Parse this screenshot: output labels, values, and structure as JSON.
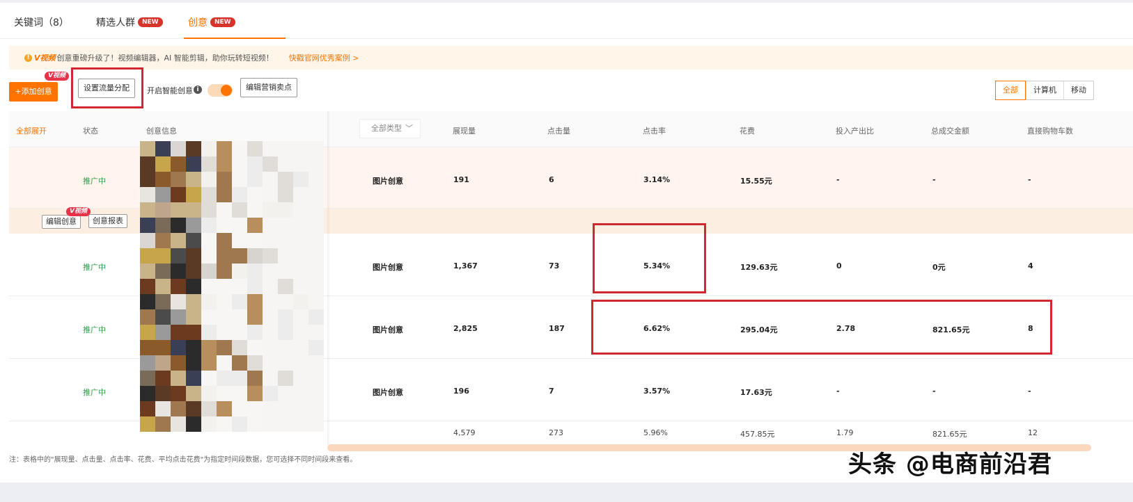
{
  "tabs": [
    {
      "label": "关键词（8）",
      "badge": ""
    },
    {
      "label": "精选人群",
      "badge": "NEW"
    },
    {
      "label": "创意",
      "badge": "NEW"
    }
  ],
  "notice": {
    "info_icon": "info-circle-icon",
    "brand": "V视频",
    "text": "创意重磅升级了！视频编辑器，AI 智能剪辑，助你玩转短视频！",
    "link": "快戳官网优秀案例 >"
  },
  "toolbar": {
    "add_label": "+添加创意",
    "v_badge": "V视频",
    "traffic_label": "设置流量分配",
    "smart_label": "开启智能创意",
    "edit_selling_label": "编辑营销卖点",
    "segments": [
      "全部",
      "计算机",
      "移动"
    ]
  },
  "table": {
    "headers": {
      "expand": "全部展开",
      "status": "状态",
      "info": "创意信息",
      "type_select": "全部类型",
      "impressions": "展现量",
      "clicks": "点击量",
      "ctr": "点击率",
      "cost": "花费",
      "roi": "投入产出比",
      "gmv": "总成交金额",
      "cart": "直接购物车数"
    },
    "rows": [
      {
        "status": "推广中",
        "type": "图片创意",
        "impressions": "191",
        "clicks": "6",
        "ctr": "3.14%",
        "cost": "15.55元",
        "roi": "-",
        "gmv": "-",
        "cart": "-"
      },
      {
        "status": "推广中",
        "type": "图片创意",
        "impressions": "1,367",
        "clicks": "73",
        "ctr": "5.34%",
        "cost": "129.63元",
        "roi": "0",
        "gmv": "0元",
        "cart": "4"
      },
      {
        "status": "推广中",
        "type": "图片创意",
        "impressions": "2,825",
        "clicks": "187",
        "ctr": "6.62%",
        "cost": "295.04元",
        "roi": "2.78",
        "gmv": "821.65元",
        "cart": "8"
      },
      {
        "status": "推广中",
        "type": "图片创意",
        "impressions": "196",
        "clicks": "7",
        "ctr": "3.57%",
        "cost": "17.63元",
        "roi": "-",
        "gmv": "-",
        "cart": "-"
      }
    ],
    "row_actions": {
      "edit": "编辑创意",
      "report": "创意报表",
      "v_badge": "V视频"
    },
    "totals": {
      "impressions": "4,579",
      "clicks": "273",
      "ctr": "5.96%",
      "cost": "457.85元",
      "roi": "1.79",
      "gmv": "821.65元",
      "cart": "12"
    }
  },
  "footnote": "注：表格中的\"展现量、点击量、点击率、花费、平均点击花费\"为指定时间段数据，您可选择不同时间段来查看。",
  "watermark": "头条 @电商前沿君",
  "colors": {
    "accent": "#ff7300",
    "status_green": "#2e9b4a",
    "highlight_box": "#d0282e"
  }
}
